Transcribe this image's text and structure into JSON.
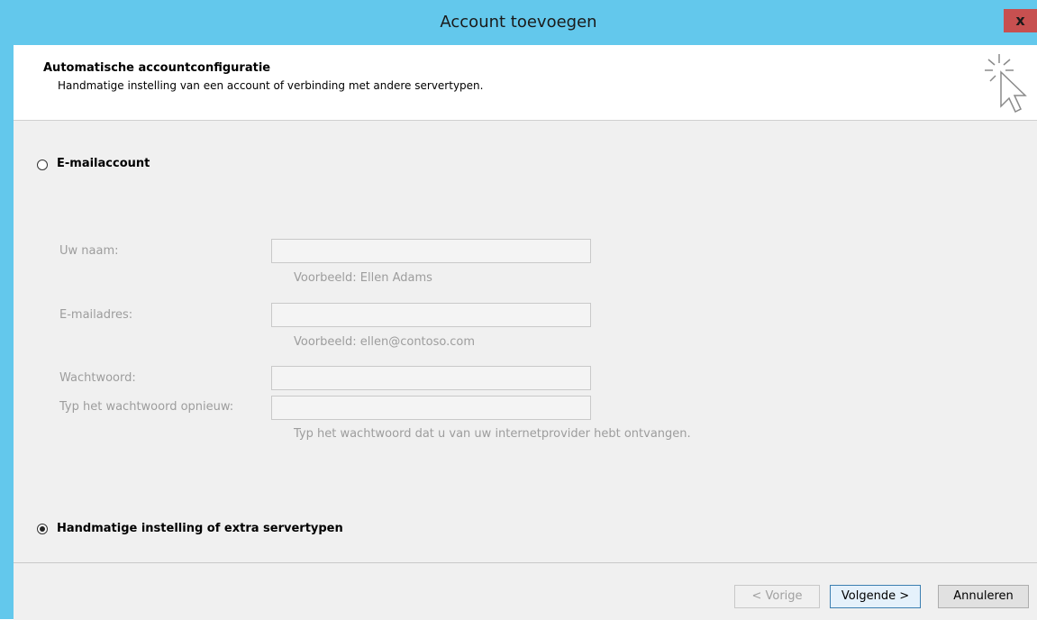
{
  "window": {
    "title": "Account toevoegen",
    "close_label": "x"
  },
  "header": {
    "title": "Automatische accountconfiguratie",
    "subtitle": "Handmatige instelling van een account of verbinding met andere servertypen."
  },
  "options": {
    "email_account": {
      "label": "E-mailaccount",
      "checked": false
    },
    "manual": {
      "label": "Handmatige instelling of extra servertypen",
      "checked": true
    }
  },
  "form": {
    "name": {
      "label": "Uw naam:",
      "value": "",
      "hint": "Voorbeeld: Ellen Adams"
    },
    "email": {
      "label": "E-mailadres:",
      "value": "",
      "hint": "Voorbeeld: ellen@contoso.com"
    },
    "password": {
      "label": "Wachtwoord:",
      "value": ""
    },
    "password_repeat": {
      "label": "Typ het wachtwoord opnieuw:",
      "value": ""
    },
    "password_hint": "Typ het wachtwoord dat u van uw internetprovider hebt ontvangen."
  },
  "buttons": {
    "back": "< Vorige",
    "next": "Volgende >",
    "cancel": "Annuleren"
  },
  "colors": {
    "titlebar": "#63c8ec",
    "close": "#c75050",
    "body": "#f0f0f0",
    "disabled_text": "#9d9d9d"
  },
  "icons": {
    "header_icon": "cursor-click-icon"
  }
}
